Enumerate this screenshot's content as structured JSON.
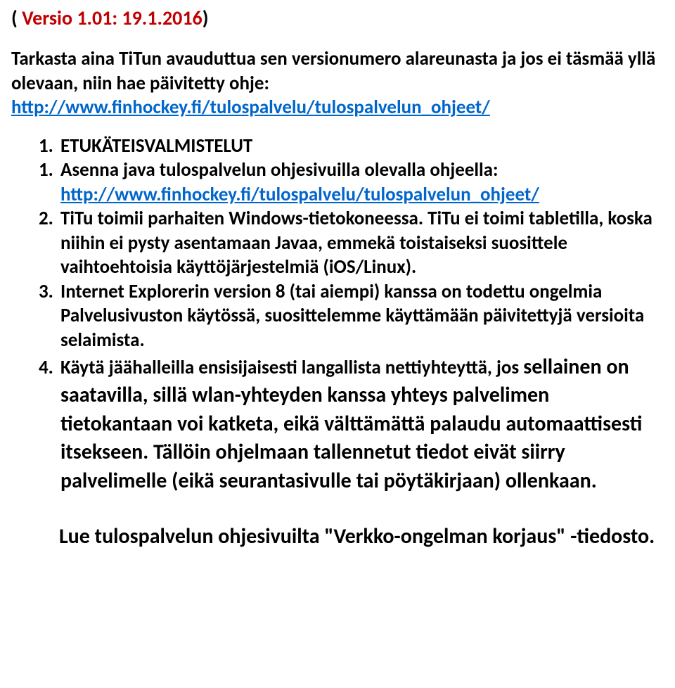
{
  "version": {
    "openParen": "( ",
    "label": "Versio 1.01:  19.1.2016",
    "closeParen": ")"
  },
  "intro": {
    "lines": "Tarkasta aina TiTun avauduttua sen versionumero alareunasta ja jos ei täsmää yllä olevaan, niin hae päivitetty ohje:",
    "linkText": "http://www.finhockey.fi/tulospalvelu/tulospalvelun_ohjeet/"
  },
  "heading": "ETUKÄTEISVALMISTELUT",
  "items": {
    "i1": {
      "text": "Asenna java tulospalvelun ohjesivuilla olevalla ohjeella:",
      "linkText": "http://www.finhockey.fi/tulospalvelu/tulospalvelun_ohjeet/"
    },
    "i2": {
      "text": "TiTu toimii parhaiten Windows-tietokoneessa. TiTu ei toimi tabletilla, koska niihin ei pysty asentamaan Javaa, emmekä toistaiseksi suosittele vaihtoehtoisia käyttöjärjestelmiä (iOS/Linux)."
    },
    "i3": {
      "text": "Internet Explorerin version 8 (tai aiempi) kanssa on todettu ongelmia Palvelusivuston käytössä, suosittelemme käyttämään päivitettyjä versioita selaimista."
    },
    "i4": {
      "lead": "Käytä jäähalleilla ensisijaisesti langallista nettiyhteyttä, jos ",
      "big": "sellainen on saatavilla, sillä wlan-yhteyden kanssa yhteys palvelimen tietokantaan voi katketa, eikä välttämättä palaudu automaattisesti itsekseen. Tällöin ohjelmaan tallennetut tiedot eivät siirry palvelimelle (eikä seurantasivulle tai pöytäkirjaan) ollenkaan."
    }
  },
  "closing": "Lue tulospalvelun ohjesivuilta \"Verkko-ongelman korjaus\" -tiedosto."
}
